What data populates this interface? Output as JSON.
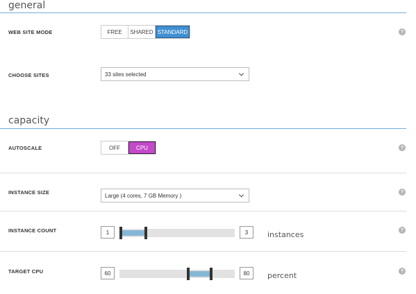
{
  "general": {
    "title": "general",
    "website_mode": {
      "label": "WEB SITE MODE",
      "options": [
        "FREE",
        "SHARED",
        "STANDARD"
      ],
      "selected": "STANDARD"
    },
    "choose_sites": {
      "label": "CHOOSE SITES",
      "value": "33 sites selected"
    }
  },
  "capacity": {
    "title": "capacity",
    "autoscale": {
      "label": "AUTOSCALE",
      "options": [
        "OFF",
        "CPU"
      ],
      "selected": "CPU"
    },
    "instance_size": {
      "label": "INSTANCE SIZE",
      "value": "Large (4 cores, 7 GB Memory )"
    },
    "instance_count": {
      "label": "INSTANCE COUNT",
      "min": "1",
      "max": "3",
      "unit": "instances",
      "scale_min": 1,
      "scale_max": 10
    },
    "target_cpu": {
      "label": "TARGET CPU",
      "min": "60",
      "max": "80",
      "unit": "percent",
      "scale_min": 0,
      "scale_max": 100
    }
  },
  "help_icon_text": "?",
  "colors": {
    "accent_blue": "#3f8fd2",
    "accent_purple": "#c34ac9",
    "section_rule": "#6aaede",
    "slider_fill": "#85b6d6"
  }
}
